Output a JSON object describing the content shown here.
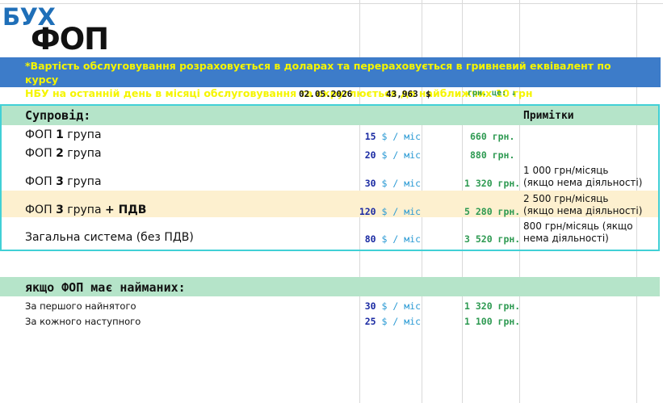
{
  "logo": {
    "top": "БУХ",
    "bottom": "ФОП"
  },
  "banner": {
    "line1": "*Вартість обслуговування розраховується в доларах та  перераховується в гривневий еквівалент по курсу",
    "line2": "НБУ на  останній день в місяці обслуговування та округлюється до  найближчих 10 грн"
  },
  "rate": {
    "date": "02.05.2026",
    "value": "43,963",
    "currency": "$",
    "note": "грн. це: ↓"
  },
  "section1": {
    "title": "Супровід:",
    "notes_header": "Примітки",
    "rows": [
      {
        "label_pre": "ФОП ",
        "label_num": "1",
        "label_post": " група",
        "usd": "15",
        "unit": "$ / міс",
        "uah": "660 грн.",
        "note1": "",
        "note2": ""
      },
      {
        "label_pre": "ФОП ",
        "label_num": "2",
        "label_post": " група",
        "usd": "20",
        "unit": "$ / міс",
        "uah": "880 грн.",
        "note1": "",
        "note2": ""
      },
      {
        "label_pre": "ФОП ",
        "label_num": "3",
        "label_post": " група",
        "usd": "30",
        "unit": "$ / міс",
        "uah": "1 320 грн.",
        "note1": "1 000 грн/місяць",
        "note2": "(якщо нема діяльності)"
      },
      {
        "label_pre": "ФОП ",
        "label_num": "3",
        "label_post": " група ",
        "label_extra": "+ ПДВ",
        "usd": "120",
        "unit": "$ / міс",
        "uah": "5 280 грн.",
        "note1": "2 500 грн/місяць",
        "note2": "(якщо нема діяльності)"
      },
      {
        "label_pre": "Загальна система (без ПДВ)",
        "label_num": "",
        "label_post": "",
        "usd": "80",
        "unit": "$ / міс",
        "uah": "3 520 грн.",
        "note1": "800 грн/місяць (якщо",
        "note2": "нема діяльності)"
      }
    ]
  },
  "section2": {
    "title": "якщо ФОП має найманих:",
    "rows": [
      {
        "label": "За першого найнятого",
        "usd": "30",
        "unit": "$ / міс",
        "uah": "1 320 грн."
      },
      {
        "label": "За кожного наступного",
        "usd": "25",
        "unit": "$ / міс",
        "uah": "1 100 грн."
      }
    ]
  },
  "colors": {
    "banner_bg": "#3d7cc9",
    "banner_text": "#f5f500",
    "header_green": "#b5e4c9",
    "highlight_row": "#fdf0cf",
    "border_cyan": "#41d0d6"
  }
}
